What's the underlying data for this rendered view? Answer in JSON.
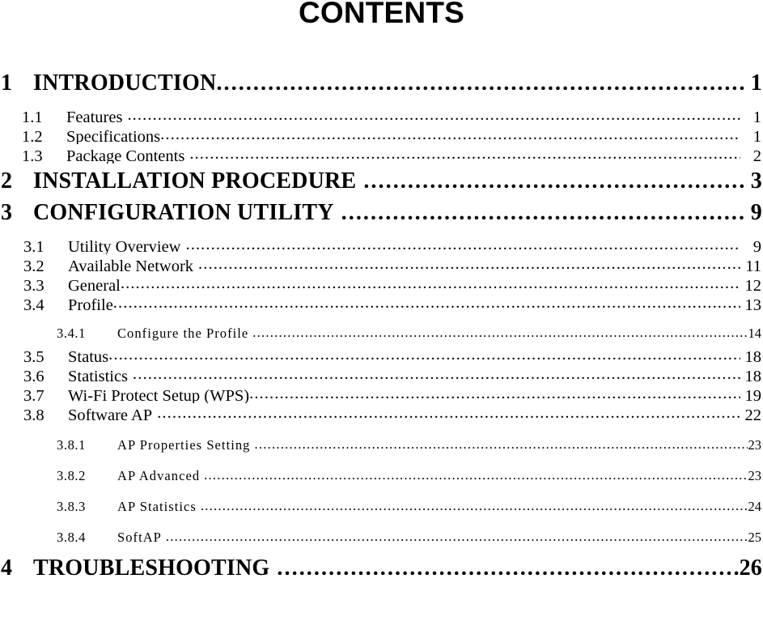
{
  "document": {
    "title": "CONTENTS"
  },
  "toc": {
    "entries": [
      {
        "level": 1,
        "number": "1",
        "label": "INTRODUCTION",
        "page": "1",
        "space_before_leader": false
      },
      {
        "level": 2,
        "number": "1.1",
        "label": "Features",
        "page": "1",
        "space_before_leader": true
      },
      {
        "level": 2,
        "number": "1.2",
        "label": "Specifications",
        "page": "1",
        "space_before_leader": false
      },
      {
        "level": 2,
        "number": "1.3",
        "label": "Package Contents",
        "page": "2",
        "space_before_leader": true
      },
      {
        "level": 1,
        "number": "2",
        "label": "INSTALLATION PROCEDURE",
        "page": "3",
        "space_before_leader": true
      },
      {
        "level": 1,
        "number": "3",
        "label": "CONFIGURATION UTILITY",
        "page": "9",
        "space_before_leader": true
      },
      {
        "level": 2,
        "number": "3.1",
        "label": "Utility Overview",
        "page": "9",
        "space_before_leader": true
      },
      {
        "level": 2,
        "number": "3.2",
        "label": "Available Network",
        "page": "11",
        "space_before_leader": true
      },
      {
        "level": 2,
        "number": "3.3",
        "label": "General",
        "page": "12",
        "space_before_leader": false
      },
      {
        "level": 2,
        "number": "3.4",
        "label": "Profile",
        "page": "13",
        "space_before_leader": false
      },
      {
        "level": 3,
        "number": "3.4.1",
        "label": "Configure the Profile",
        "page": "14",
        "space_before_leader": true
      },
      {
        "level": 2,
        "number": "3.5",
        "label": "Status",
        "page": "18",
        "space_before_leader": false
      },
      {
        "level": 2,
        "number": "3.6",
        "label": "Statistics",
        "page": "18",
        "space_before_leader": true
      },
      {
        "level": 2,
        "number": "3.7",
        "label": "Wi-Fi Protect Setup (WPS)",
        "page": "19",
        "space_before_leader": false
      },
      {
        "level": 2,
        "number": "3.8",
        "label": "Software AP",
        "page": "22",
        "space_before_leader": true
      },
      {
        "level": 3,
        "number": "3.8.1",
        "label": "AP Properties Setting",
        "page": "23",
        "space_before_leader": true
      },
      {
        "level": 3,
        "number": "3.8.2",
        "label": "AP Advanced",
        "page": "23",
        "space_before_leader": true
      },
      {
        "level": 3,
        "number": "3.8.3",
        "label": "AP Statistics",
        "page": "24",
        "space_before_leader": true
      },
      {
        "level": 3,
        "number": "3.8.4",
        "label": "SoftAP",
        "page": "25",
        "space_before_leader": true
      },
      {
        "level": 1,
        "number": "4",
        "label": "TROUBLESHOOTING",
        "page": "26",
        "space_before_leader": true
      }
    ]
  }
}
